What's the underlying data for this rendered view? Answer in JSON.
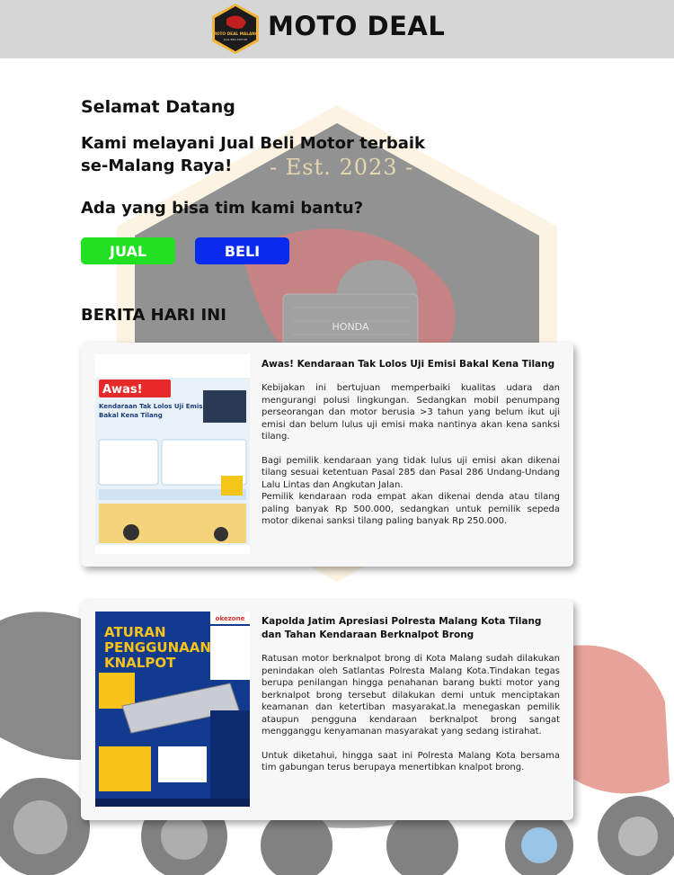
{
  "header": {
    "brand": "MOTO DEAL",
    "logo_text_top": "MOTO DEAL MALANG",
    "logo_text_bottom": "JUAL BELI MOTOR"
  },
  "background": {
    "est_text": "- Est. 2023 -",
    "bike_brand": "HONDA"
  },
  "intro": {
    "welcome": "Selamat Datang",
    "tagline_line1": "Kami melayani Jual Beli Motor terbaik",
    "tagline_line2": "se-Malang Raya!",
    "question": "Ada yang bisa tim kami bantu?"
  },
  "buttons": {
    "jual": "JUAL",
    "beli": "BELI"
  },
  "news": {
    "heading": "BERITA HARI INI",
    "articles": [
      {
        "thumb_headline": "Awas!",
        "thumb_subtitle": "Kendaraan Tak Lolos Uji Emisi Bakal Kena Tilang",
        "title": "Awas! Kendaraan Tak Lolos Uji Emisi Bakal Kena Tilang",
        "para1": "Kebijakan ini bertujuan memperbaiki kualitas udara dan mengurangi polusi lingkungan. Sedangkan mobil penumpang perseorangan dan motor berusia >3 tahun yang belum ikut uji emisi dan belum lulus uji emisi maka nantinya akan kena sanksi tilang.",
        "para2": "Bagi pemilik kendaraan yang tidak lulus uji emisi akan dikenai tilang sesuai ketentuan Pasal 285 dan Pasal 286 Undang-Undang Lalu Lintas dan Angkutan Jalan.",
        "para3": "Pemilik kendaraan roda empat akan dikenai denda atau tilang paling banyak Rp 500.000, sedangkan untuk pemilik sepeda motor dikenai sanksi tilang paling banyak Rp 250.000."
      },
      {
        "thumb_headline": "ATURAN PENGGUNAAN KNALPOT",
        "thumb_source": "okezone",
        "title": "Kapolda Jatim Apresiasi Polresta Malang Kota Tilang dan Tahan Kendaraan Berknalpot Brong",
        "para1": "Ratusan motor berknalpot brong di Kota Malang sudah dilakukan penindakan oleh Satlantas Polresta Malang Kota.Tindakan tegas berupa penilangan hingga penahanan barang bukti motor yang berknalpot brong tersebut dilakukan demi untuk menciptakan keamanan dan ketertiban masyarakat.la menegaskan pemilik ataupun pengguna kendaraan berknalpot brong sangat mengganggu kenyamanan masyarakat yang sedang istirahat.",
        "para2": "Untuk diketahui, hingga saat ini Polresta Malang Kota bersama tim gabungan terus berupaya menertibkan knalpot brong."
      }
    ]
  }
}
